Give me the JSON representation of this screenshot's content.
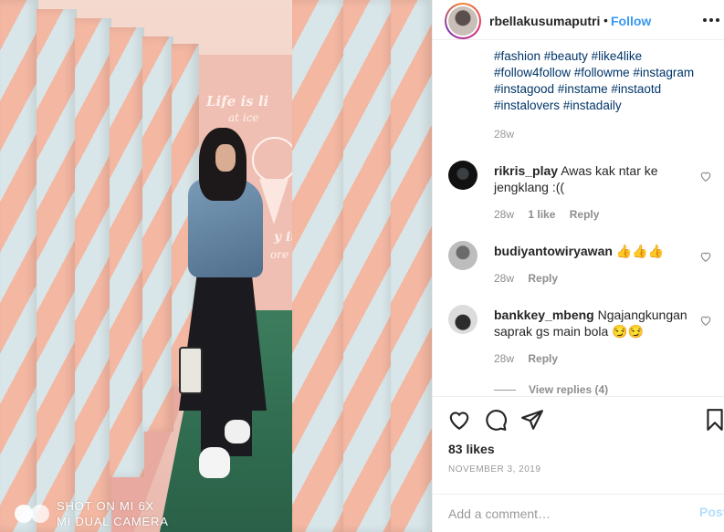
{
  "photo": {
    "wall_text_1": "Life is li",
    "wall_text_2": "at ice",
    "wall_text_3": "y it",
    "wall_text_4": "ore it",
    "watermark_line1": "SHOT ON MI 6X",
    "watermark_line2": "MI DUAL CAMERA"
  },
  "header": {
    "username": "rbellakusumaputri",
    "separator": "•",
    "follow_label": "Follow",
    "more_icon": "more-options-icon"
  },
  "caption": {
    "lines": [
      "#fashion #beauty #like4like",
      "#follow4follow #followme #instagram",
      "#instagood #instame #instaotd",
      "#instalovers #instadaily"
    ],
    "time": "28w"
  },
  "comments": [
    {
      "username": "rikris_play",
      "text": "Awas kak ntar ke jengklang :((",
      "time": "28w",
      "likes": "1 like",
      "reply": "Reply"
    },
    {
      "username": "budiyantowiryawan",
      "text": "👍👍👍",
      "time": "28w",
      "likes": "",
      "reply": "Reply"
    },
    {
      "username": "bankkey_mbeng",
      "text": "Ngajangkungan saprak gs main bola 😏😏",
      "time": "28w",
      "likes": "",
      "reply": "Reply"
    }
  ],
  "view_replies": "View replies (4)",
  "actions": {
    "like_icon": "heart-icon",
    "comment_icon": "comment-icon",
    "share_icon": "share-icon",
    "save_icon": "bookmark-icon"
  },
  "like_count": "83 likes",
  "post_date": "NOVEMBER 3, 2019",
  "add_comment": {
    "placeholder": "Add a comment…",
    "post_label": "Post"
  },
  "colors": {
    "link_blue": "#3897f0",
    "hashtag": "#003569",
    "post_disabled": "#b2dffc"
  }
}
